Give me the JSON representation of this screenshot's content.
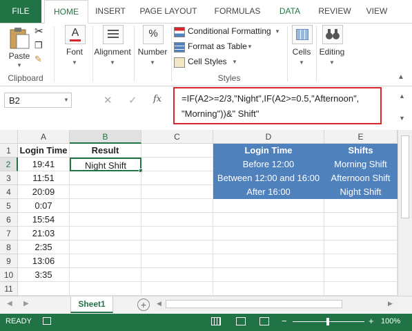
{
  "ribbon_tabs": [
    "FILE",
    "HOME",
    "INSERT",
    "PAGE LAYOUT",
    "FORMULAS",
    "DATA",
    "REVIEW",
    "VIEW"
  ],
  "clipboard": {
    "paste": "Paste",
    "group": "Clipboard"
  },
  "font": {
    "label": "Font"
  },
  "alignment": {
    "label": "Alignment"
  },
  "number": {
    "label": "Number"
  },
  "styles": {
    "conditional": "Conditional Formatting",
    "format_table": "Format as Table",
    "cell_styles": "Cell Styles",
    "group": "Styles"
  },
  "cells": {
    "label": "Cells"
  },
  "editing": {
    "label": "Editing"
  },
  "namebox": "B2",
  "fx": "fx",
  "formula_line1": "=IF(A2>=2/3,\"Night\",IF(A2>=0.5,\"Afternoon\",",
  "formula_line2": "\"Morning\"))&\" Shift\"",
  "columns": [
    "A",
    "B",
    "C",
    "D",
    "E"
  ],
  "rows": [
    "1",
    "2",
    "3",
    "4",
    "5",
    "6",
    "7",
    "8",
    "9",
    "10",
    "11"
  ],
  "colA": [
    "Login Time",
    "19:41",
    "11:51",
    "20:09",
    "0:07",
    "15:54",
    "21:03",
    "2:35",
    "13:06",
    "3:35",
    ""
  ],
  "colB": [
    "Result",
    "Night Shift",
    "",
    "",
    "",
    "",
    "",
    "",
    "",
    "",
    ""
  ],
  "colD": [
    "Login Time",
    "Before 12:00",
    "Between 12:00 and 16:00",
    "After 16:00"
  ],
  "colE": [
    "Shifts",
    "Morning Shift",
    "Afternoon Shift",
    "Night Shift"
  ],
  "sheet": {
    "name": "Sheet1",
    "add": "+"
  },
  "status": {
    "ready": "READY",
    "zoom": "100%",
    "minus": "−",
    "plus": "+"
  },
  "colors": {
    "excel_green": "#217346",
    "table_blue": "#4f81bd",
    "highlight_red": "#d9242b"
  }
}
